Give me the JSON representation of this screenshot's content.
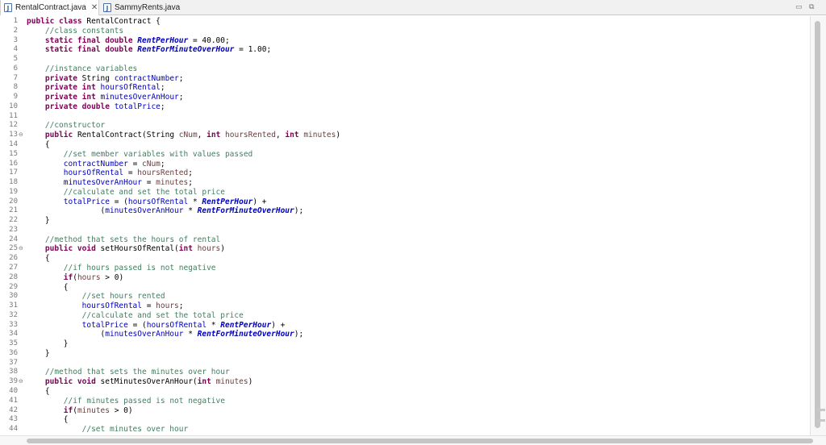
{
  "tabs": [
    {
      "label": "RentalContract.java",
      "active": true,
      "closable": true,
      "icon": "java-file-icon"
    },
    {
      "label": "SammyRents.java",
      "active": false,
      "closable": false,
      "icon": "java-file-icon"
    }
  ],
  "window_controls": [
    "minimize-icon",
    "maximize-icon"
  ],
  "colors": {
    "keyword": "#7f0055",
    "comment": "#3f7f5f",
    "field": "#0000c0",
    "parameter": "#6a3e3e",
    "line_number": "#787878"
  },
  "code_lines": [
    {
      "n": "1",
      "fold": false,
      "tokens": [
        [
          "kw",
          "public class"
        ],
        [
          "p",
          " RentalContract {"
        ]
      ]
    },
    {
      "n": "2",
      "fold": false,
      "tokens": [
        [
          "p",
          "    "
        ],
        [
          "cm",
          "//class constants"
        ]
      ]
    },
    {
      "n": "3",
      "fold": false,
      "tokens": [
        [
          "p",
          "    "
        ],
        [
          "kw",
          "static final double"
        ],
        [
          "p",
          " "
        ],
        [
          "sf",
          "RentPerHour"
        ],
        [
          "p",
          " = 40.00;"
        ]
      ]
    },
    {
      "n": "4",
      "fold": false,
      "tokens": [
        [
          "p",
          "    "
        ],
        [
          "kw",
          "static final double"
        ],
        [
          "p",
          " "
        ],
        [
          "sf",
          "RentForMinuteOverHour"
        ],
        [
          "p",
          " = 1.00;"
        ]
      ]
    },
    {
      "n": "5",
      "fold": false,
      "tokens": []
    },
    {
      "n": "6",
      "fold": false,
      "tokens": [
        [
          "p",
          "    "
        ],
        [
          "cm",
          "//instance variables"
        ]
      ]
    },
    {
      "n": "7",
      "fold": false,
      "tokens": [
        [
          "p",
          "    "
        ],
        [
          "kw",
          "private"
        ],
        [
          "p",
          " String "
        ],
        [
          "fd",
          "contractNumber"
        ],
        [
          "p",
          ";"
        ]
      ]
    },
    {
      "n": "8",
      "fold": false,
      "tokens": [
        [
          "p",
          "    "
        ],
        [
          "kw",
          "private int"
        ],
        [
          "p",
          " "
        ],
        [
          "fd",
          "hoursOfRental"
        ],
        [
          "p",
          ";"
        ]
      ]
    },
    {
      "n": "9",
      "fold": false,
      "tokens": [
        [
          "p",
          "    "
        ],
        [
          "kw",
          "private int"
        ],
        [
          "p",
          " "
        ],
        [
          "fd",
          "minutesOverAnHour"
        ],
        [
          "p",
          ";"
        ]
      ]
    },
    {
      "n": "10",
      "fold": false,
      "tokens": [
        [
          "p",
          "    "
        ],
        [
          "kw",
          "private double"
        ],
        [
          "p",
          " "
        ],
        [
          "fd",
          "totalPrice"
        ],
        [
          "p",
          ";"
        ]
      ]
    },
    {
      "n": "11",
      "fold": false,
      "tokens": []
    },
    {
      "n": "12",
      "fold": false,
      "tokens": [
        [
          "p",
          "    "
        ],
        [
          "cm",
          "//constructor"
        ]
      ]
    },
    {
      "n": "13",
      "fold": true,
      "tokens": [
        [
          "p",
          "    "
        ],
        [
          "kw",
          "public"
        ],
        [
          "p",
          " RentalContract(String "
        ],
        [
          "pm",
          "cNum"
        ],
        [
          "p",
          ", "
        ],
        [
          "kw",
          "int"
        ],
        [
          "p",
          " "
        ],
        [
          "pm",
          "hoursRented"
        ],
        [
          "p",
          ", "
        ],
        [
          "kw",
          "int"
        ],
        [
          "p",
          " "
        ],
        [
          "pm",
          "minutes"
        ],
        [
          "p",
          ")"
        ]
      ]
    },
    {
      "n": "14",
      "fold": false,
      "tokens": [
        [
          "p",
          "    {"
        ]
      ]
    },
    {
      "n": "15",
      "fold": false,
      "tokens": [
        [
          "p",
          "        "
        ],
        [
          "cm",
          "//set member variables with values passed"
        ]
      ]
    },
    {
      "n": "16",
      "fold": false,
      "tokens": [
        [
          "p",
          "        "
        ],
        [
          "fd",
          "contractNumber"
        ],
        [
          "p",
          " = "
        ],
        [
          "pm",
          "cNum"
        ],
        [
          "p",
          ";"
        ]
      ]
    },
    {
      "n": "17",
      "fold": false,
      "tokens": [
        [
          "p",
          "        "
        ],
        [
          "fd",
          "hoursOfRental"
        ],
        [
          "p",
          " = "
        ],
        [
          "pm",
          "hoursRented"
        ],
        [
          "p",
          ";"
        ]
      ]
    },
    {
      "n": "18",
      "fold": false,
      "tokens": [
        [
          "p",
          "        "
        ],
        [
          "fd",
          "minutesOverAnHour"
        ],
        [
          "p",
          " = "
        ],
        [
          "pm",
          "minutes"
        ],
        [
          "p",
          ";"
        ]
      ]
    },
    {
      "n": "19",
      "fold": false,
      "tokens": [
        [
          "p",
          "        "
        ],
        [
          "cm",
          "//calculate and set the total price"
        ]
      ]
    },
    {
      "n": "20",
      "fold": false,
      "tokens": [
        [
          "p",
          "        "
        ],
        [
          "fd",
          "totalPrice"
        ],
        [
          "p",
          " = ("
        ],
        [
          "fd",
          "hoursOfRental"
        ],
        [
          "p",
          " * "
        ],
        [
          "sf",
          "RentPerHour"
        ],
        [
          "p",
          ") +"
        ]
      ]
    },
    {
      "n": "21",
      "fold": false,
      "tokens": [
        [
          "p",
          "                ("
        ],
        [
          "fd",
          "minutesOverAnHour"
        ],
        [
          "p",
          " * "
        ],
        [
          "sf",
          "RentForMinuteOverHour"
        ],
        [
          "p",
          ");"
        ]
      ]
    },
    {
      "n": "22",
      "fold": false,
      "tokens": [
        [
          "p",
          "    }"
        ]
      ]
    },
    {
      "n": "23",
      "fold": false,
      "tokens": []
    },
    {
      "n": "24",
      "fold": false,
      "tokens": [
        [
          "p",
          "    "
        ],
        [
          "cm",
          "//method that sets the hours of rental"
        ]
      ]
    },
    {
      "n": "25",
      "fold": true,
      "tokens": [
        [
          "p",
          "    "
        ],
        [
          "kw",
          "public void"
        ],
        [
          "p",
          " setHoursOfRental("
        ],
        [
          "kw",
          "int"
        ],
        [
          "p",
          " "
        ],
        [
          "pm",
          "hours"
        ],
        [
          "p",
          ")"
        ]
      ]
    },
    {
      "n": "26",
      "fold": false,
      "tokens": [
        [
          "p",
          "    {"
        ]
      ]
    },
    {
      "n": "27",
      "fold": false,
      "tokens": [
        [
          "p",
          "        "
        ],
        [
          "cm",
          "//if hours passed is not negative"
        ]
      ]
    },
    {
      "n": "28",
      "fold": false,
      "tokens": [
        [
          "p",
          "        "
        ],
        [
          "kw",
          "if"
        ],
        [
          "p",
          "("
        ],
        [
          "pm",
          "hours"
        ],
        [
          "p",
          " > 0)"
        ]
      ]
    },
    {
      "n": "29",
      "fold": false,
      "tokens": [
        [
          "p",
          "        {"
        ]
      ]
    },
    {
      "n": "30",
      "fold": false,
      "tokens": [
        [
          "p",
          "            "
        ],
        [
          "cm",
          "//set hours rented"
        ]
      ]
    },
    {
      "n": "31",
      "fold": false,
      "tokens": [
        [
          "p",
          "            "
        ],
        [
          "fd",
          "hoursOfRental"
        ],
        [
          "p",
          " = "
        ],
        [
          "pm",
          "hours"
        ],
        [
          "p",
          ";"
        ]
      ]
    },
    {
      "n": "32",
      "fold": false,
      "tokens": [
        [
          "p",
          "            "
        ],
        [
          "cm",
          "//calculate and set the total price"
        ]
      ]
    },
    {
      "n": "33",
      "fold": false,
      "tokens": [
        [
          "p",
          "            "
        ],
        [
          "fd",
          "totalPrice"
        ],
        [
          "p",
          " = ("
        ],
        [
          "fd",
          "hoursOfRental"
        ],
        [
          "p",
          " * "
        ],
        [
          "sf",
          "RentPerHour"
        ],
        [
          "p",
          ") +"
        ]
      ]
    },
    {
      "n": "34",
      "fold": false,
      "tokens": [
        [
          "p",
          "                ("
        ],
        [
          "fd",
          "minutesOverAnHour"
        ],
        [
          "p",
          " * "
        ],
        [
          "sf",
          "RentForMinuteOverHour"
        ],
        [
          "p",
          ");"
        ]
      ]
    },
    {
      "n": "35",
      "fold": false,
      "tokens": [
        [
          "p",
          "        }"
        ]
      ]
    },
    {
      "n": "36",
      "fold": false,
      "tokens": [
        [
          "p",
          "    }"
        ]
      ]
    },
    {
      "n": "37",
      "fold": false,
      "tokens": []
    },
    {
      "n": "38",
      "fold": false,
      "tokens": [
        [
          "p",
          "    "
        ],
        [
          "cm",
          "//method that sets the minutes over hour"
        ]
      ]
    },
    {
      "n": "39",
      "fold": true,
      "tokens": [
        [
          "p",
          "    "
        ],
        [
          "kw",
          "public void"
        ],
        [
          "p",
          " setMinutesOverAnHour("
        ],
        [
          "kw",
          "int"
        ],
        [
          "p",
          " "
        ],
        [
          "pm",
          "minutes"
        ],
        [
          "p",
          ")"
        ]
      ]
    },
    {
      "n": "40",
      "fold": false,
      "tokens": [
        [
          "p",
          "    {"
        ]
      ]
    },
    {
      "n": "41",
      "fold": false,
      "tokens": [
        [
          "p",
          "        "
        ],
        [
          "cm",
          "//if minutes passed is not negative"
        ]
      ]
    },
    {
      "n": "42",
      "fold": false,
      "tokens": [
        [
          "p",
          "        "
        ],
        [
          "kw",
          "if"
        ],
        [
          "p",
          "("
        ],
        [
          "pm",
          "minutes"
        ],
        [
          "p",
          " > 0)"
        ]
      ]
    },
    {
      "n": "43",
      "fold": false,
      "tokens": [
        [
          "p",
          "        {"
        ]
      ]
    },
    {
      "n": "44",
      "fold": false,
      "tokens": [
        [
          "p",
          "            "
        ],
        [
          "cm",
          "//set minutes over hour"
        ]
      ]
    }
  ]
}
